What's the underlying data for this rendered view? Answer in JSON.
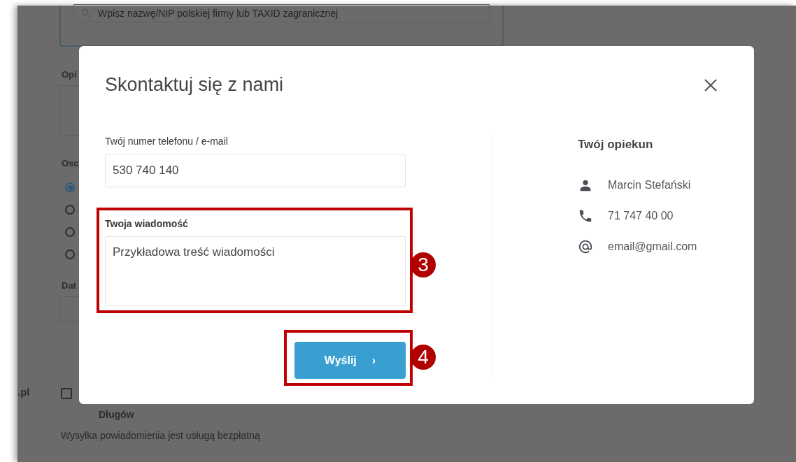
{
  "background_page": {
    "search": {
      "placeholder": "Wpisz nazwę/NIP polskiej firmy lub TAXID zagranicznej"
    },
    "description_label": "Opi",
    "person_label": "Osc",
    "radios": [
      {
        "selected": true
      },
      {
        "selected": false
      },
      {
        "selected": false
      },
      {
        "selected": false
      }
    ],
    "date_label": "Dat",
    "side_text": ".pl",
    "checkbox": {
      "checked": false
    },
    "checkbox_label": "Długów",
    "note": "Wysyłka powiadomienia jest usługą bezpłatną"
  },
  "dialog": {
    "title": "Skontaktuj się z nami",
    "fields": [
      {
        "kind": "input",
        "label": "Twój numer telefonu / e-mail",
        "value": "530 740 140"
      },
      {
        "kind": "textarea",
        "label": "Twoja wiadomość",
        "value": "Przykładowa treść wiadomości"
      }
    ],
    "submit": {
      "label": "Wyślij",
      "arrow": "›"
    },
    "advisor": {
      "title": "Twój opiekun",
      "items": [
        {
          "kind": "person",
          "text": "Marcin  Stefański"
        },
        {
          "kind": "phone",
          "text": "71 747 40 00"
        },
        {
          "kind": "email",
          "text": "email@gmail.com"
        }
      ]
    }
  },
  "annotations": [
    {
      "kind": "message",
      "number": "3"
    },
    {
      "kind": "submit",
      "number": "4"
    }
  ]
}
